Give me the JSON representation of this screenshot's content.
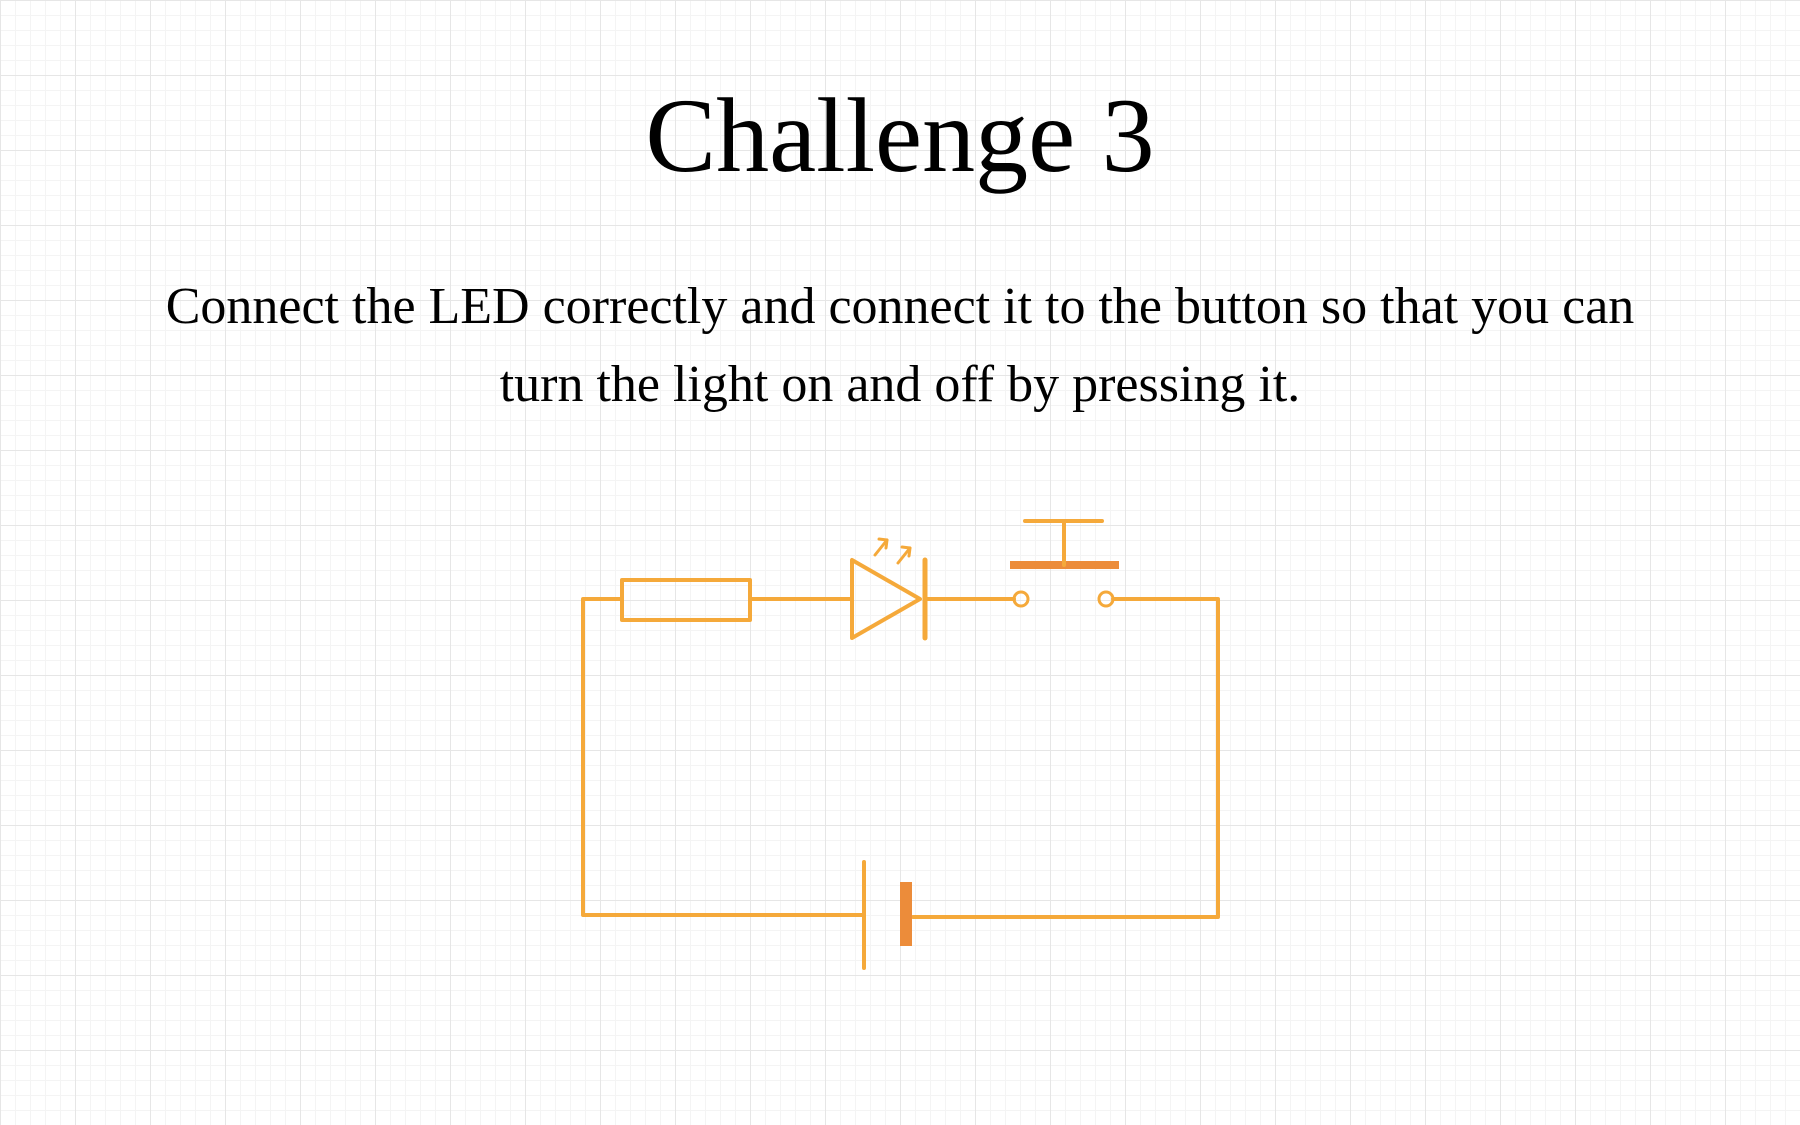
{
  "slide": {
    "title": "Challenge 3",
    "instruction": "Connect the LED correctly and connect it to the button so that you can turn the light on and off by pressing it."
  },
  "diagram": {
    "components": [
      "resistor",
      "led",
      "push-button",
      "battery"
    ],
    "stroke_color": "#f5a93a",
    "plate_color": "#ec8c3a"
  }
}
